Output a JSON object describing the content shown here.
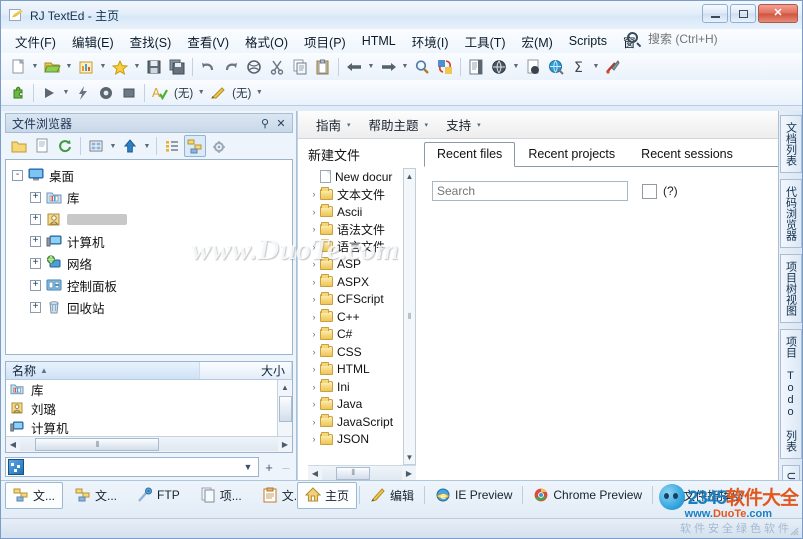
{
  "window": {
    "title": "RJ TextEd - 主页",
    "icon": "pencil-document-icon",
    "controls": {
      "minimize": "–",
      "maximize": "□",
      "close": "✕"
    }
  },
  "menubar": {
    "items": [
      {
        "label": "文件(F)",
        "name": "menu-file"
      },
      {
        "label": "编辑(E)",
        "name": "menu-edit"
      },
      {
        "label": "查找(S)",
        "name": "menu-search"
      },
      {
        "label": "查看(V)",
        "name": "menu-view"
      },
      {
        "label": "格式(O)",
        "name": "menu-format"
      },
      {
        "label": "项目(P)",
        "name": "menu-project"
      },
      {
        "label": "HTML",
        "name": "menu-html"
      },
      {
        "label": "环境(I)",
        "name": "menu-environment"
      },
      {
        "label": "工具(T)",
        "name": "menu-tools"
      },
      {
        "label": "宏(M)",
        "name": "menu-macro"
      },
      {
        "label": "Scripts",
        "name": "menu-scripts"
      },
      {
        "label": "窗",
        "name": "menu-window"
      }
    ],
    "search": {
      "placeholder": "搜索 (Ctrl+H)",
      "value": "",
      "icon": "search-icon"
    }
  },
  "toolbar_row1": {
    "items": [
      {
        "name": "new-file-button",
        "icon": "new-document-icon",
        "dropdown": true
      },
      {
        "name": "open-file-button",
        "icon": "open-folder-icon",
        "dropdown": true
      },
      {
        "name": "open-project-button",
        "icon": "project-chart-icon",
        "dropdown": true
      },
      {
        "name": "favorites-button",
        "icon": "star-icon",
        "dropdown": true
      },
      {
        "name": "save-button",
        "icon": "floppy-save-icon",
        "dropdown": false
      },
      {
        "name": "save-all-button",
        "icon": "save-all-icon",
        "dropdown": false
      },
      {
        "name": "undo-button",
        "icon": "undo-arrow-icon",
        "dropdown": false
      },
      {
        "name": "redo-button",
        "icon": "redo-arrow-icon",
        "dropdown": false
      },
      {
        "name": "reload-button",
        "icon": "globe-refresh-icon",
        "dropdown": false
      },
      {
        "name": "cut-button",
        "icon": "scissors-icon",
        "dropdown": false
      },
      {
        "name": "copy-button",
        "icon": "copy-icon",
        "dropdown": false
      },
      {
        "name": "paste-button",
        "icon": "paste-clipboard-icon",
        "dropdown": false
      },
      {
        "name": "back-button",
        "icon": "arrow-left-icon",
        "dropdown": true
      },
      {
        "name": "forward-button",
        "icon": "arrow-right-icon",
        "dropdown": true
      },
      {
        "name": "find-button",
        "icon": "magnifier-icon",
        "dropdown": false
      },
      {
        "name": "replace-button",
        "icon": "replace-swap-icon",
        "dropdown": false
      },
      {
        "name": "document-map-button",
        "icon": "document-map-icon",
        "dropdown": false
      },
      {
        "name": "web-preview-button",
        "icon": "globe-dark-icon",
        "dropdown": true
      },
      {
        "name": "page-preview-button",
        "icon": "page-globe-icon",
        "dropdown": false
      },
      {
        "name": "browser-button",
        "icon": "globe-color-icon",
        "dropdown": false
      },
      {
        "name": "sum-button",
        "icon": "sigma-icon",
        "dropdown": true
      },
      {
        "name": "options-button",
        "icon": "tools-icon",
        "dropdown": false
      }
    ]
  },
  "toolbar_row2": {
    "items": [
      {
        "name": "plugin-button",
        "icon": "plugin-puzzle-icon",
        "dropdown": false
      },
      {
        "name": "run-button",
        "icon": "play-icon",
        "dropdown": true
      },
      {
        "name": "compile-button",
        "icon": "lightning-icon",
        "dropdown": false
      },
      {
        "name": "record-macro-button",
        "icon": "record-circle-icon",
        "dropdown": false
      },
      {
        "name": "stop-macro-button",
        "icon": "stop-square-icon",
        "dropdown": false
      }
    ],
    "spellcheck": {
      "icon": "spellcheck-icon",
      "label": "(无)",
      "dropdown": true
    },
    "highlighter": {
      "icon": "pencil-icon",
      "label": "(无)",
      "dropdown": true
    }
  },
  "file_browser": {
    "caption": "文件浏览器",
    "pin_icon": "pin-icon",
    "close_icon": "close-icon",
    "toolbar": [
      {
        "name": "new-folder-button",
        "icon": "folder-icon"
      },
      {
        "name": "new-file-button",
        "icon": "page-icon"
      },
      {
        "name": "refresh-button",
        "icon": "refresh-icon"
      },
      {
        "name": "view-mode-button",
        "icon": "view-grid-icon",
        "dropdown": true
      },
      {
        "name": "up-level-button",
        "icon": "arrow-up-icon",
        "dropdown": true
      },
      {
        "name": "details-view-button",
        "icon": "list-details-icon"
      },
      {
        "name": "tree-view-button",
        "icon": "tree-view-icon",
        "pressed": true
      },
      {
        "name": "settings-button",
        "icon": "gear-icon"
      }
    ],
    "tree": [
      {
        "label": "桌面",
        "icon": "desktop-icon",
        "expander": "-",
        "level": 0
      },
      {
        "label": "库",
        "icon": "library-icon",
        "expander": "+",
        "level": 1
      },
      {
        "label": "",
        "icon": "user-folder-icon",
        "expander": "+",
        "level": 1,
        "blurred": true
      },
      {
        "label": "计算机",
        "icon": "computer-icon",
        "expander": "+",
        "level": 1
      },
      {
        "label": "网络",
        "icon": "network-icon",
        "expander": "+",
        "level": 1
      },
      {
        "label": "控制面板",
        "icon": "control-panel-icon",
        "expander": "+",
        "level": 1
      },
      {
        "label": "回收站",
        "icon": "recycle-bin-icon",
        "expander": "+",
        "level": 1
      }
    ],
    "list_columns": [
      {
        "label": "名称",
        "sort": "▲"
      },
      {
        "label": "大小",
        "sort": "▲"
      }
    ],
    "list_rows": [
      {
        "name": "库",
        "icon": "library-icon"
      },
      {
        "name": "刘璐",
        "icon": "user-folder-icon"
      },
      {
        "name": "计算机",
        "icon": "computer-icon"
      }
    ],
    "path_combo": {
      "value": "",
      "icon": "folder-network-icon",
      "caret": "▼"
    },
    "add_button": "+",
    "remove_button": "–"
  },
  "help_bar": {
    "items": [
      {
        "label": "指南",
        "name": "guide-menu"
      },
      {
        "label": "帮助主题",
        "name": "help-topics-menu"
      },
      {
        "label": "支持",
        "name": "support-menu"
      }
    ],
    "caret": "▾"
  },
  "new_file_pane": {
    "title": "新建文件",
    "items": [
      {
        "label": "New docur",
        "icon": "document-icon",
        "arrow": false
      },
      {
        "label": "文本文件",
        "icon": "folder-icon",
        "arrow": true
      },
      {
        "label": "Ascii",
        "icon": "folder-icon",
        "arrow": true
      },
      {
        "label": "语法文件",
        "icon": "folder-icon",
        "arrow": true
      },
      {
        "label": "语言文件",
        "icon": "folder-icon",
        "arrow": true
      },
      {
        "label": "ASP",
        "icon": "folder-icon",
        "arrow": true
      },
      {
        "label": "ASPX",
        "icon": "folder-icon",
        "arrow": true
      },
      {
        "label": "CFScript",
        "icon": "folder-icon",
        "arrow": true
      },
      {
        "label": "C++",
        "icon": "folder-icon",
        "arrow": true
      },
      {
        "label": "C#",
        "icon": "folder-icon",
        "arrow": true
      },
      {
        "label": "CSS",
        "icon": "folder-icon",
        "arrow": true
      },
      {
        "label": "HTML",
        "icon": "folder-icon",
        "arrow": true
      },
      {
        "label": "Ini",
        "icon": "folder-icon",
        "arrow": true
      },
      {
        "label": "Java",
        "icon": "folder-icon",
        "arrow": true
      },
      {
        "label": "JavaScript",
        "icon": "folder-icon",
        "arrow": true
      },
      {
        "label": "JSON",
        "icon": "folder-icon",
        "arrow": true
      }
    ]
  },
  "recent_pane": {
    "tabs": [
      {
        "label": "Recent files",
        "active": true
      },
      {
        "label": "Recent projects",
        "active": false
      },
      {
        "label": "Recent sessions",
        "active": false
      }
    ],
    "search": {
      "placeholder": "Search",
      "value": ""
    },
    "checkbox_checked": false,
    "hint": "(?)"
  },
  "right_dock": {
    "tabs": [
      {
        "label": "文档列表",
        "name": "vtab-document-list"
      },
      {
        "label": "代码浏览器",
        "name": "vtab-code-explorer"
      },
      {
        "label": "项目树视图",
        "name": "vtab-project-tree"
      },
      {
        "label": "项目 Todo 列表",
        "name": "vtab-project-todo"
      },
      {
        "label": "Unit Conv",
        "name": "vtab-unit-converter"
      }
    ]
  },
  "bottom_tabs_left": [
    {
      "label": "文...",
      "icon": "file-explorer-icon",
      "active": true,
      "name": "bottom-tab-file-browser"
    },
    {
      "label": "文...",
      "icon": "file-explorer-icon",
      "active": false,
      "name": "bottom-tab-file-browser-2"
    },
    {
      "label": "FTP",
      "icon": "ftp-icon",
      "active": false,
      "name": "bottom-tab-ftp"
    },
    {
      "label": "项...",
      "icon": "project-icon",
      "active": false,
      "name": "bottom-tab-project"
    },
    {
      "label": "文...",
      "icon": "clipboard-icon",
      "active": false,
      "name": "bottom-tab-documents"
    }
  ],
  "bottom_tabs_main": [
    {
      "label": "主页",
      "icon": "home-icon",
      "active": true,
      "name": "bottom-tab-home"
    },
    {
      "label": "编辑",
      "icon": "pencil-icon",
      "active": false,
      "name": "bottom-tab-edit"
    },
    {
      "label": "IE Preview",
      "icon": "ie-icon",
      "active": false,
      "name": "bottom-tab-ie-preview"
    },
    {
      "label": "Chrome Preview",
      "icon": "chrome-icon",
      "active": false,
      "name": "bottom-tab-chrome-preview"
    },
    {
      "label": "文件指挥部",
      "icon": "file-commander-icon",
      "active": false,
      "name": "bottom-tab-file-commander"
    }
  ],
  "watermarks": {
    "center": "www.DuoTe.com",
    "brand": "2345",
    "brand_cn": "软件大全",
    "brand_url_prefix": "www.",
    "brand_url_mid": "DuoTe",
    "brand_url_suffix": ".com",
    "bottom": "软件安全绿色软件"
  },
  "colors": {
    "accent": "#1a7fc1",
    "brand_orange": "#e2571e",
    "title_text": "#13324f",
    "close_red": "#cf543f"
  }
}
